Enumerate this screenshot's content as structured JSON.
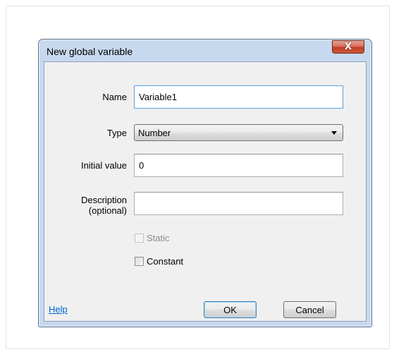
{
  "dialog": {
    "title": "New global variable",
    "close_glyph": "X"
  },
  "form": {
    "name_label": "Name",
    "name_value": "Variable1",
    "type_label": "Type",
    "type_value": "Number",
    "initial_label": "Initial value",
    "initial_value": "0",
    "description_label_line1": "Description",
    "description_label_line2": "(optional)",
    "description_value": ""
  },
  "checkboxes": {
    "static_label": "Static",
    "static_checked": false,
    "static_enabled": false,
    "constant_label": "Constant",
    "constant_checked": false
  },
  "footer": {
    "help_label": "Help",
    "ok_label": "OK",
    "cancel_label": "Cancel"
  },
  "icons": {
    "close": "close-icon",
    "dropdown": "chevron-down-icon"
  },
  "colors": {
    "window_frame": "#c7d9ee",
    "close_button": "#c23d25",
    "link": "#0066cc",
    "focus_border": "#569de5"
  }
}
